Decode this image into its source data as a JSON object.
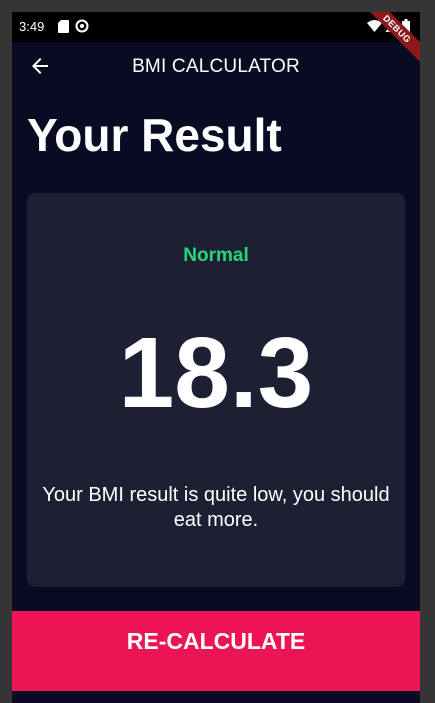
{
  "status_bar": {
    "time": "3:49",
    "left_icons": [
      "sd-card-icon",
      "sync-icon"
    ],
    "right_icons": [
      "wifi-icon",
      "signal-icon",
      "battery-icon"
    ],
    "debug_label": "DEBUG"
  },
  "app_bar": {
    "title": "BMI CALCULATOR",
    "back_icon": "arrow-back-icon"
  },
  "page": {
    "title": "Your Result"
  },
  "result": {
    "status": "Normal",
    "status_color": "#24d876",
    "value": "18.3",
    "message": "Your BMI result is quite low, you should eat more."
  },
  "action": {
    "recalculate_label": "RE-CALCULATE",
    "button_color": "#eb1555"
  },
  "colors": {
    "background": "#080b22",
    "card": "#1d1f33"
  }
}
